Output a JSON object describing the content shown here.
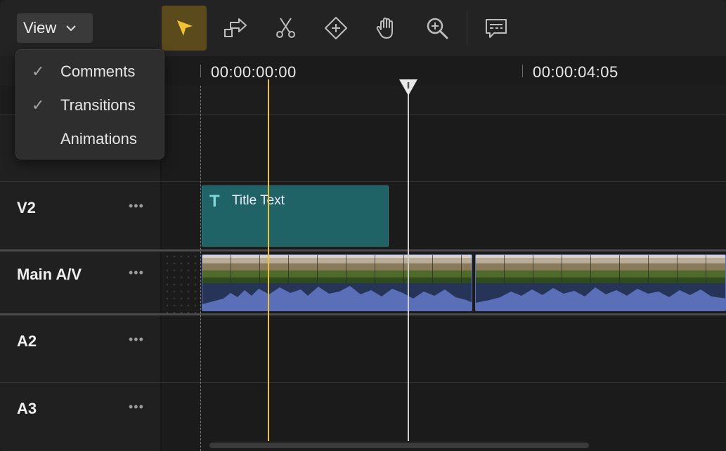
{
  "toolbar": {
    "view_label": "View",
    "tools": [
      {
        "name": "select-tool",
        "icon": "arrow-pointer-icon",
        "active": true
      },
      {
        "name": "ripple-tool",
        "icon": "swap-arrows-icon",
        "active": false
      },
      {
        "name": "razor-tool",
        "icon": "scissors-icon",
        "active": false
      },
      {
        "name": "keyframe-tool",
        "icon": "diamond-plus-icon",
        "active": false
      },
      {
        "name": "hand-tool",
        "icon": "hand-icon",
        "active": false
      },
      {
        "name": "zoom-tool",
        "icon": "magnifier-plus-icon",
        "active": false
      },
      {
        "name": "comment-tool",
        "icon": "speech-bubble-icon",
        "active": false
      }
    ],
    "accent": "#f2c233"
  },
  "view_menu": {
    "items": [
      {
        "label": "Comments",
        "checked": true
      },
      {
        "label": "Transitions",
        "checked": true
      },
      {
        "label": "Animations",
        "checked": false
      }
    ]
  },
  "ruler": {
    "start_timecode": "00:00:00:00",
    "mid_timecode": "00:00:04:05"
  },
  "tracks": [
    {
      "name": "V2"
    },
    {
      "name": "Main A/V"
    },
    {
      "name": "A2"
    },
    {
      "name": "A3"
    }
  ],
  "more_glyph": "•••",
  "clips": {
    "title_clip": {
      "icon_glyph": "T",
      "label": "Title Text",
      "color": "#1f6366"
    }
  },
  "colors": {
    "playhead_yellow": "#f2c233",
    "av_clip_border": "#5b6fb8",
    "audio_wave": "#5b6fb8"
  }
}
